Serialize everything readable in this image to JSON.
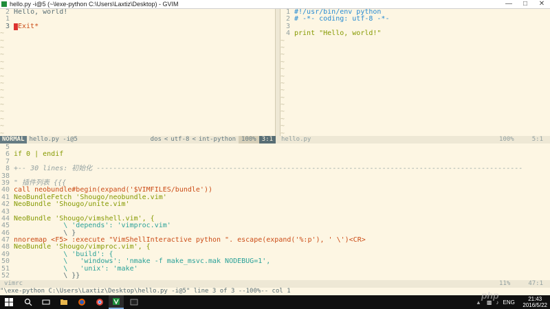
{
  "window": {
    "title": "hello.py -i@5 (~\\lexe-python C:\\Users\\Laxtiz\\Desktop) - GVIM"
  },
  "left_pane": {
    "lines": [
      {
        "num": "2",
        "text": "Hello, world!"
      },
      {
        "num": "1",
        "text": ""
      },
      {
        "num": "3",
        "text": "Exit*"
      }
    ],
    "tilde_count": 15
  },
  "right_pane": {
    "lines": [
      {
        "num": "1",
        "text": "#!/usr/bin/env python"
      },
      {
        "num": "2",
        "text": "# -*- coding: utf-8 -*-"
      },
      {
        "num": "3",
        "text": ""
      },
      {
        "num": "4",
        "text": "print \"Hello, world!\""
      }
    ],
    "tilde_count": 14
  },
  "statusline_left": {
    "mode": "NORMAL",
    "file": "hello.py -i@5",
    "format": "dos",
    "encoding": "utf-8",
    "filetype": "int-python",
    "percent": "100%",
    "position": "3:1"
  },
  "statusline_right": {
    "file": "hello.py",
    "percent": "100%",
    "position": "5:1"
  },
  "bottom_pane": {
    "lines": [
      {
        "num": "5",
        "text": ""
      },
      {
        "num": "6",
        "text": "if 0 | endif"
      },
      {
        "num": "7",
        "text": ""
      },
      {
        "num": "8",
        "text": "+-- 30 lines: 初始化 -------------------------------------------------------------------------------------------------------"
      },
      {
        "num": "38",
        "text": ""
      },
      {
        "num": "39",
        "text": "\" 插件列表 {{{"
      },
      {
        "num": "40",
        "text": "call neobundle#begin(expand('$VIMFILES/bundle'))"
      },
      {
        "num": "41",
        "text": "NeoBundleFetch 'Shougo/neobundle.vim'"
      },
      {
        "num": "42",
        "text": "NeoBundle 'Shougo/unite.vim'"
      },
      {
        "num": "43",
        "text": ""
      },
      {
        "num": "44",
        "text": "NeoBundle 'Shougo/vimshell.vim', {"
      },
      {
        "num": "45",
        "text": "            \\ 'depends': 'vimproc.vim'"
      },
      {
        "num": "46",
        "text": "            \\ }"
      },
      {
        "num": "47",
        "text": "nnoremap <F5> :execute \"VimShellInteractive python \". escape(expand('%:p'), ' \\')<CR>"
      },
      {
        "num": "48",
        "text": "NeoBundle 'Shougo/vimproc.vim', {"
      },
      {
        "num": "49",
        "text": "            \\ 'build': {"
      },
      {
        "num": "50",
        "text": "            \\   'windows': 'nmake -f make_msvc.mak NODEBUG=1',"
      },
      {
        "num": "51",
        "text": "            \\   'unix': 'make'"
      },
      {
        "num": "52",
        "text": "            \\ }}"
      }
    ]
  },
  "statusline_bottom": {
    "file": "vimrc",
    "percent": "11%",
    "position": "47:1"
  },
  "cmdline": {
    "text": "\"\\exe-python C:\\Users\\Laxtiz\\Desktop\\hello.py -i@5\"  line 3 of 3 --100%-- col 1"
  },
  "taskbar": {
    "tray_lang": "ENG",
    "clock_time": "21:43",
    "clock_date": "2016/5/22",
    "watermark": "php"
  }
}
